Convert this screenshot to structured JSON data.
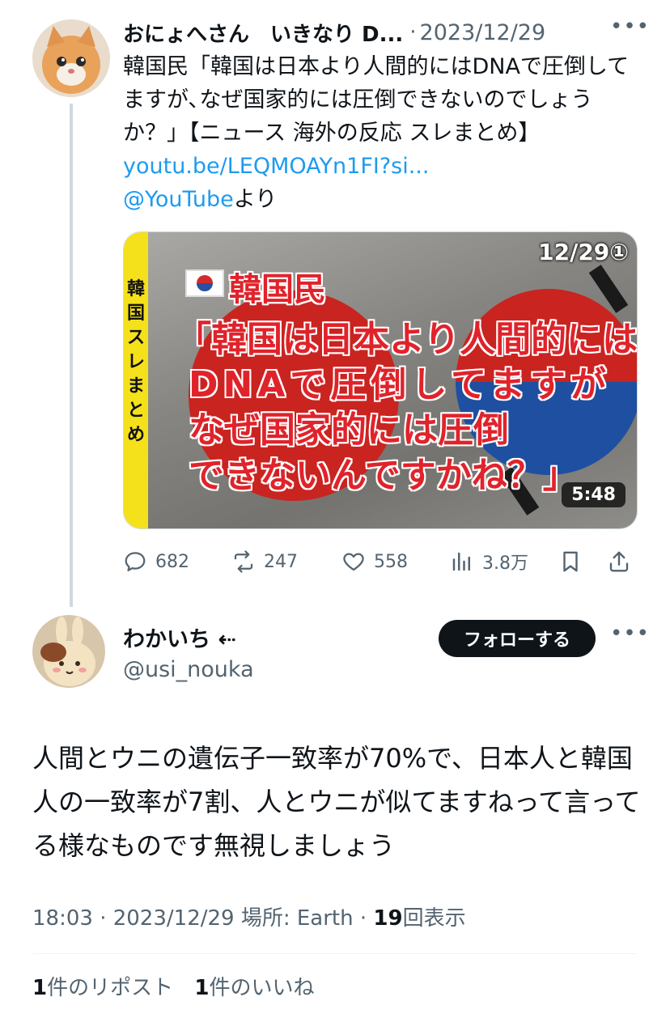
{
  "thread": {
    "parent": {
      "author_name": "おにょへさん　いきなり D...",
      "separator": "·",
      "date": "2023/12/29",
      "more_icon": "more-horizontal-icon",
      "text_main": "韓国民「韓国は日本より人間的にはDNAで圧倒してますが､なぜ国家的には圧倒できないのでしょうか？」【ニュース 海外の反応 スレまとめ】",
      "text_link": "youtu.be/LEQMOAYn1FI?si...",
      "text_mention": "@YouTube",
      "text_suffix": "より",
      "card": {
        "side_label": [
          "韓",
          "国",
          "ス",
          "レ",
          "ま",
          "と",
          "め"
        ],
        "counter": "12/29①",
        "title_lines": [
          "韓国民",
          "「韓国は日本より人間的には",
          "DNAで圧倒してますが",
          "なぜ国家的には圧倒",
          "できないんですかね？」"
        ],
        "duration": "5:48"
      },
      "actions": {
        "replies": "682",
        "reposts": "247",
        "likes": "558",
        "views": "3.8万"
      }
    },
    "main": {
      "author_name": "わかいち",
      "name_suffix": "⇠",
      "handle": "@usi_nouka",
      "follow_label": "フォローする",
      "text": "人間とウニの遺伝子一致率が70%で、日本人と韓国人の一致率が7割、人とウニが似てますねって言ってる様なものです無視しましょう",
      "meta_time": "18:03 · 2023/12/29 場所: Earth · ",
      "meta_views_count": "19",
      "meta_views_label": "回表示",
      "reposts_count": "1",
      "reposts_label": "件のリポスト",
      "likes_count": "1",
      "likes_label": "件のいいね"
    }
  },
  "colors": {
    "text": "#0f1419",
    "secondary": "#536471",
    "link": "#1d9bf0",
    "follow_button": "#0f1419"
  }
}
